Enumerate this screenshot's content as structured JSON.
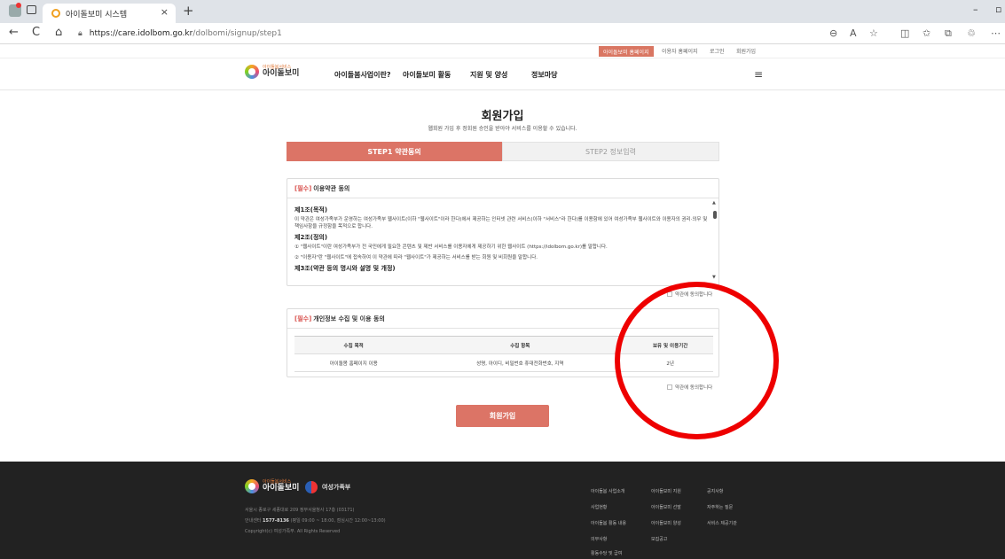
{
  "browser": {
    "tab_title": "아이돌보미 시스템",
    "tab_close": "×",
    "new_tab": "+",
    "url_domain": "https://care.idolbom.go.kr",
    "url_path": "/dolbomi/signup/step1",
    "back": "←",
    "reload": "C",
    "home": "⌂",
    "lock": "🔒︎",
    "minimize": "–",
    "restore": "▫"
  },
  "utility": {
    "home_link": "아이돌보미 홈페이지",
    "user_home": "이용자 홈페이지",
    "login": "로그인",
    "signup": "회원가입"
  },
  "gnb": {
    "logo_sub": "아이돌봄서비스",
    "logo_main": "아이돌보미",
    "menu": [
      "아이돌봄사업이란?",
      "아이돌보미 활동",
      "지원 및 양성",
      "정보마당"
    ],
    "hamburger": "≡"
  },
  "page": {
    "title": "회원가입",
    "subtitle": "웹회원 가입 후 정회원 승인을 받아야 서비스를 이용할 수 있습니다."
  },
  "steps": [
    {
      "label": "STEP1 약관동의",
      "active": true
    },
    {
      "label": "STEP2 정보입력",
      "active": false
    }
  ],
  "terms": {
    "req_tag": "[필수]",
    "heading": "이용약관 동의",
    "art1_title": "제1조(목적)",
    "art1_body": "이 약관은 여성가족부가 운영하는 여성가족부 웹사이트(이하 \"웹사이트\"이라 한다)에서 제공하는 인터넷 관련 서비스(이하 \"서비스\"라 한다)를 이용함에 있어 여성가족부 웹사이트와 이용자의 권리·의무 및 책임사항을 규정함을 목적으로 합니다.",
    "art2_title": "제2조(정의)",
    "art2_p1": "① \"웹사이트\"이란 여성가족부가 전 국민에게 필요한 콘텐츠 및 제반 서비스를 이용자에게 제공하기 위한 웹사이트 (https://idolbom.go.kr)를 말합니다.",
    "art2_p2": "② \"이용자\"란 \"웹사이트\"에 접속하여 이 약관에 따라 \"웹사이트\"가 제공하는 서비스를 받는 회원 및 비회원을 말합니다.",
    "art3_title": "제3조(약관 등의 명시와 설명 및 개정)",
    "agree_label": "약관에 동의합니다"
  },
  "privacy": {
    "req_tag": "[필수]",
    "heading": "개인정보 수집 및 이용 동의",
    "columns": [
      "수집 목적",
      "수집 항목",
      "보유 및 이용기간"
    ],
    "rows": [
      [
        "아이돌봄 홈페이지 이용",
        "성명, 아이디, 비밀번호 휴대전화번호, 지역",
        "2년"
      ]
    ],
    "agree_label": "약관에 동의합니다"
  },
  "submit_label": "회원가입",
  "footer": {
    "logo_sub": "아이돌봄서비스",
    "logo_main": "아이돌보미",
    "ministry": "여성가족부",
    "address": "서울시 종로구 세종대로 209 정부서울청사 17층 (03171)",
    "call_prefix": "안내센터",
    "call_number": "1577-8136",
    "call_suffix": "(평일 09:00 ~ 18:00, 점심시간 12:00~13:00)",
    "copyright": "Copyright(c) 여성가족부. All Rights Reserved",
    "links": [
      [
        "아이돌봄 사업소개",
        "아이돌보미 지원",
        "공지사항"
      ],
      [
        "사업현황",
        "아이돌보미 선발",
        "자주하는 질문"
      ],
      [
        "아이돌봄 활동 내용",
        "아이돌보미 양성",
        "서비스 제공기관"
      ],
      [
        "의무사항",
        "모집공고",
        ""
      ],
      [
        "활동수당 및 급여",
        "",
        ""
      ]
    ]
  },
  "colors": {
    "accent": "#dc7466",
    "annotation": "#ee0000",
    "footer_bg": "#222222"
  }
}
